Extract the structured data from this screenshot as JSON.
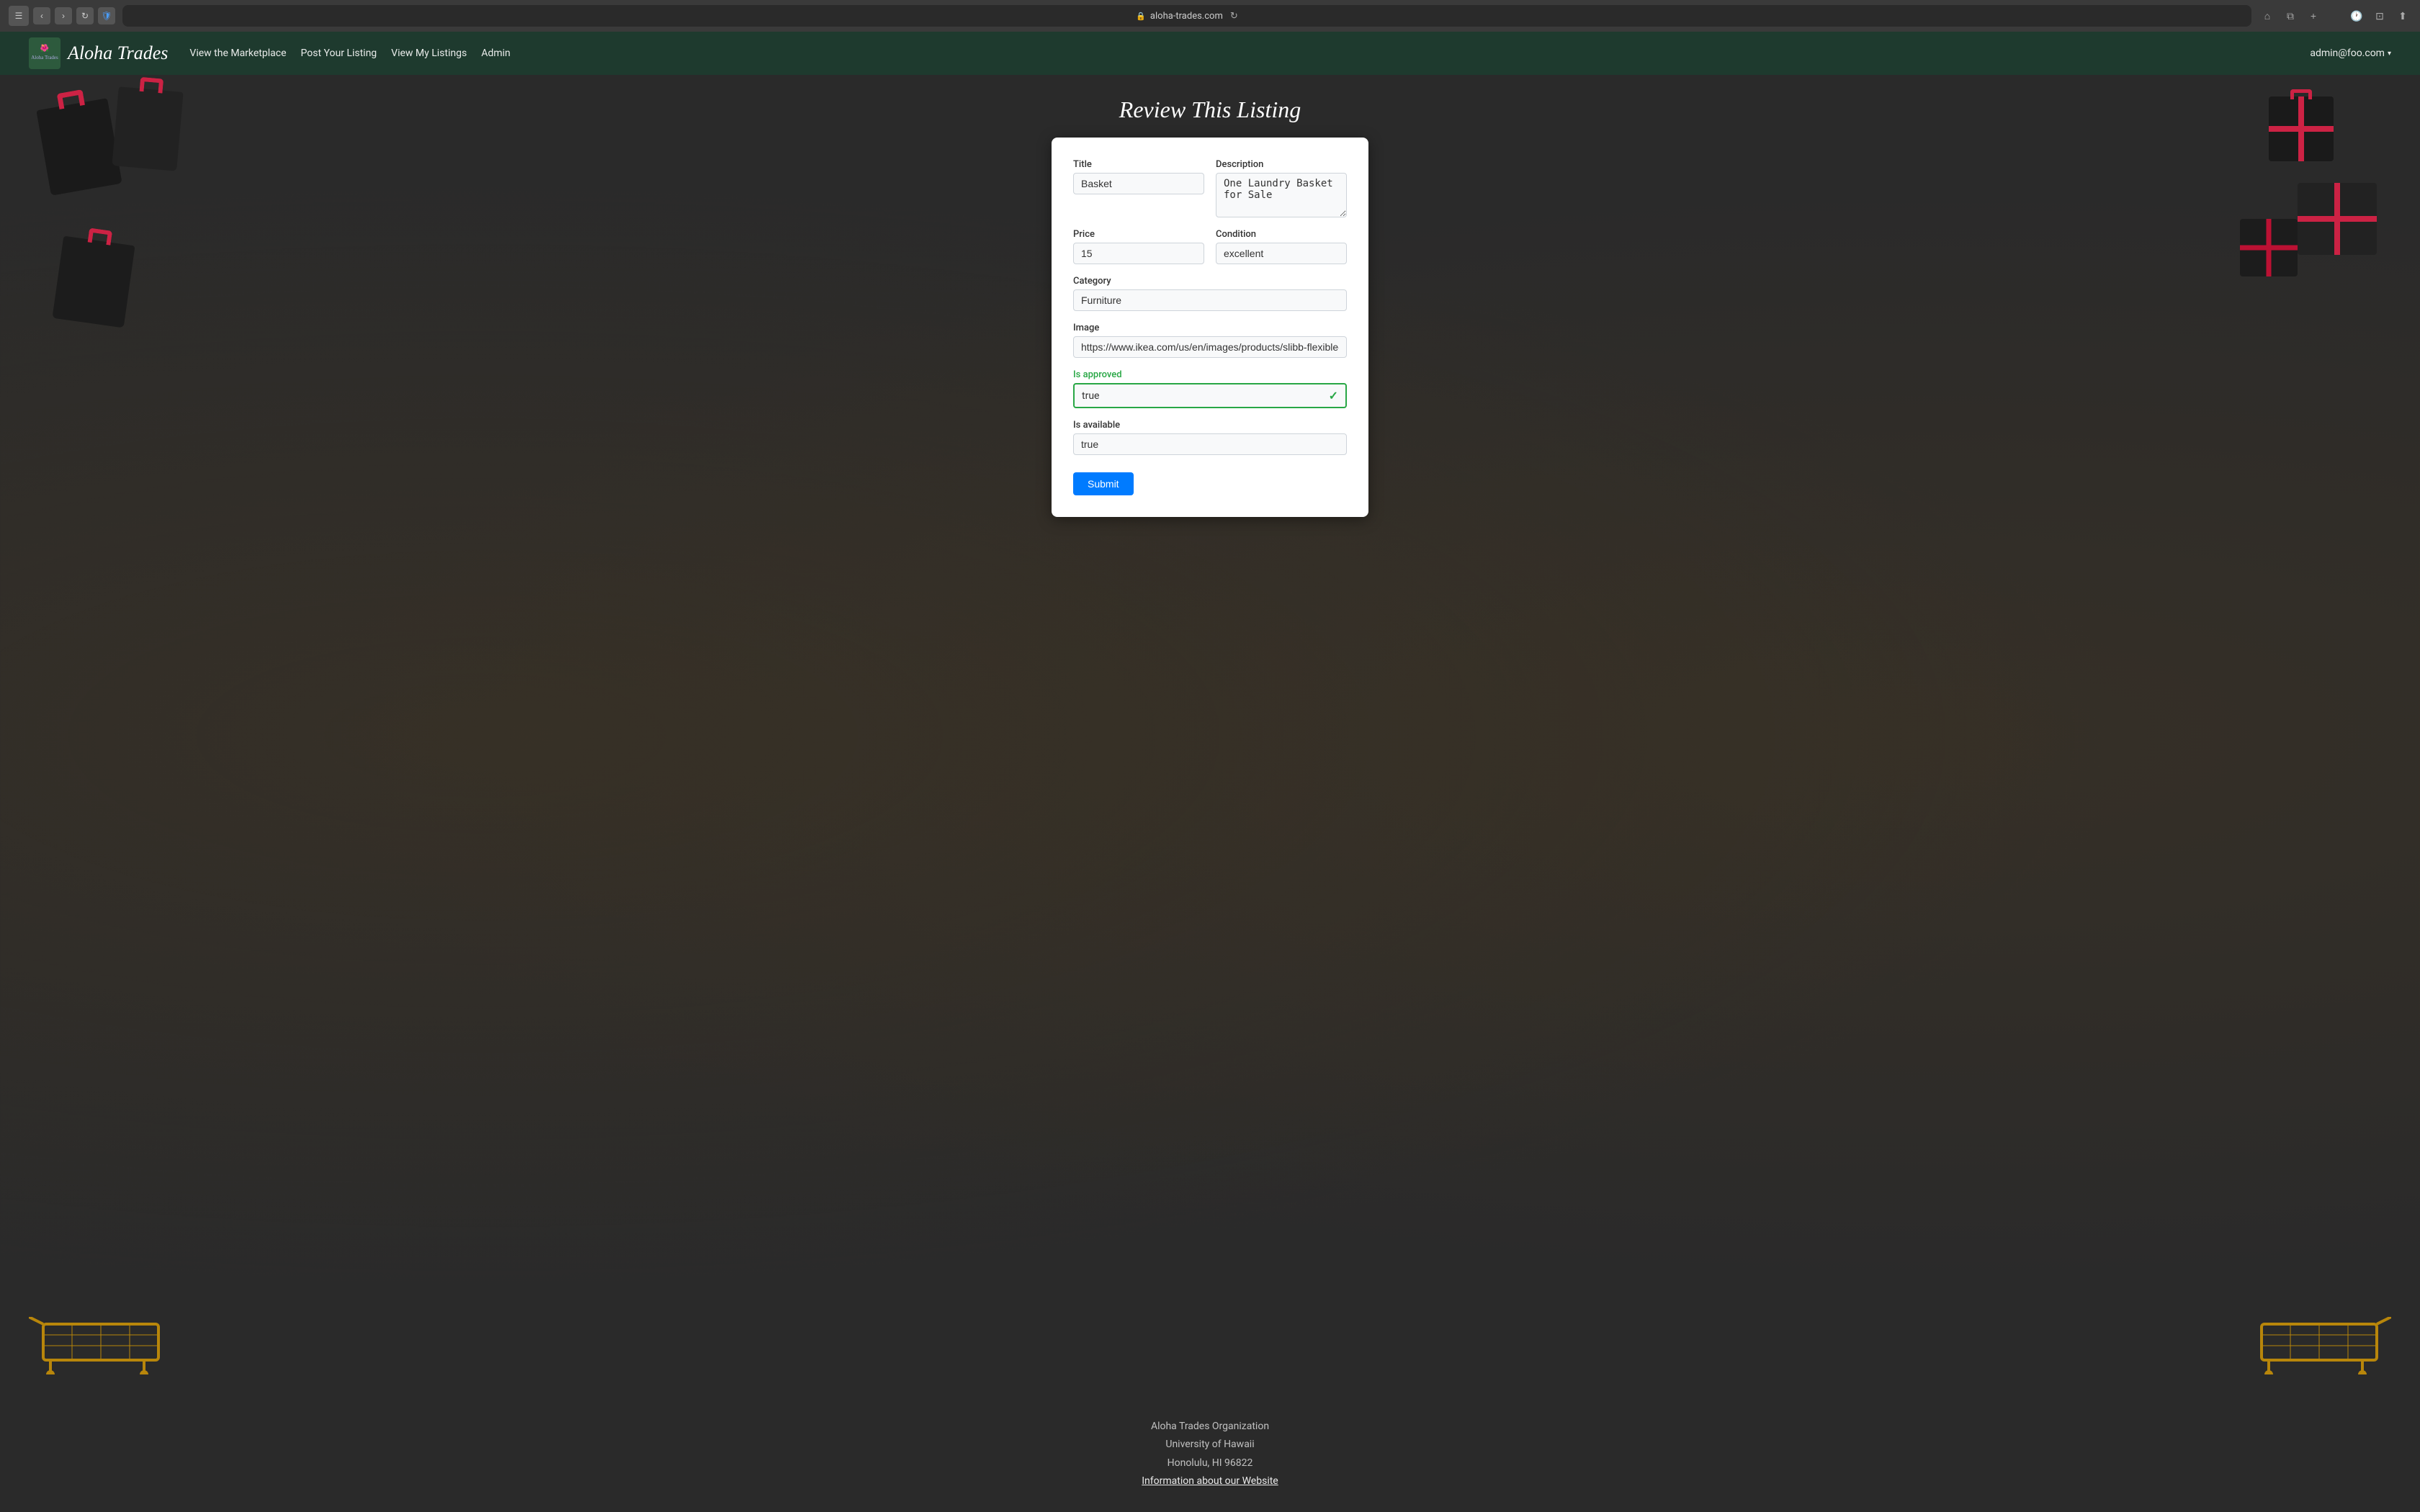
{
  "browser": {
    "url": "aloha-trades.com",
    "lock_icon": "🔒"
  },
  "navbar": {
    "brand_name": "Aloha Trades",
    "brand_logo_text": "🌺\nAloha Trades",
    "links": [
      {
        "label": "View the Marketplace",
        "id": "view-marketplace"
      },
      {
        "label": "Post Your Listing",
        "id": "post-listing"
      },
      {
        "label": "View My Listings",
        "id": "view-my-listings"
      },
      {
        "label": "Admin",
        "id": "admin"
      }
    ],
    "user_email": "admin@foo.com"
  },
  "page": {
    "title": "Review This Listing"
  },
  "form": {
    "title_label": "Title",
    "title_value": "Basket",
    "description_label": "Description",
    "description_value": "One Laundry Basket for Sale",
    "price_label": "Price",
    "price_value": "15",
    "condition_label": "Condition",
    "condition_value": "excellent",
    "category_label": "Category",
    "category_value": "Furniture",
    "image_label": "Image",
    "image_value": "https://www.ikea.com/us/en/images/products/slibb-flexible-launc",
    "is_approved_label": "Is approved",
    "is_approved_value": "true",
    "is_available_label": "Is available",
    "is_available_value": "true",
    "submit_label": "Submit"
  },
  "footer": {
    "org": "Aloha Trades Organization",
    "university": "University of Hawaii",
    "location": "Honolulu, HI 96822",
    "info_link": "Information about our Website"
  }
}
